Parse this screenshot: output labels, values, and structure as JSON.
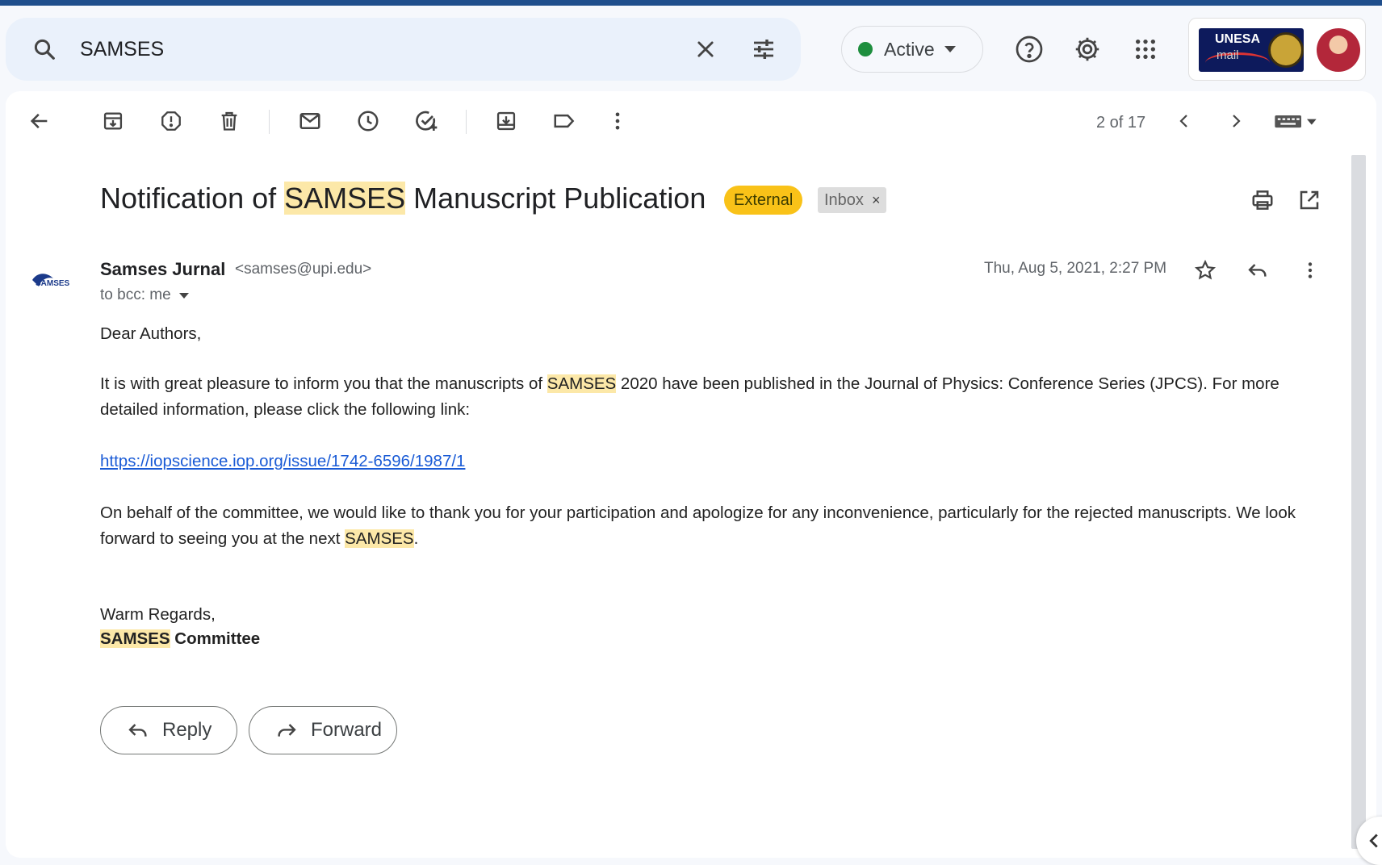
{
  "search": {
    "query": "SAMSES"
  },
  "status": {
    "label": "Active",
    "color": "#1e8e3e"
  },
  "account": {
    "org_logo_line1": "UNESA",
    "org_logo_line2": "mail"
  },
  "toolbar": {
    "pager": "2 of 17"
  },
  "email": {
    "subject_pre": "Notification of ",
    "subject_hl": "SAMSES",
    "subject_post": " Manuscript Publication",
    "label_external": "External",
    "label_inbox": "Inbox",
    "sender_name": "Samses Jurnal",
    "sender_email": "<samses@upi.edu>",
    "to_line": "to bcc: me",
    "date": "Thu, Aug 5, 2021, 2:27 PM",
    "body": {
      "greeting": "Dear Authors,",
      "p1_pre": "It is with great pleasure to inform you that the manuscripts of ",
      "p1_hl": "SAMSES",
      "p1_post": " 2020 have been published in the Journal of Physics: Conference Series (JPCS). For more detailed information, please click the following link:",
      "link": "https://iopscience.iop.org/issue/1742-6596/1987/1",
      "p2_pre": "On behalf of the committee, we would like to thank you for your participation and apologize for any inconvenience, particularly for the rejected manuscripts. We look forward to seeing you at the next ",
      "p2_hl": "SAMSES",
      "p2_post": ".",
      "closing": "Warm Regards,",
      "sig_hl": "SAMSES",
      "sig_post": " Committee"
    }
  },
  "actions": {
    "reply": "Reply",
    "forward": "Forward"
  },
  "colors": {
    "highlight": "#fce8a8",
    "external_badge": "#f9c218",
    "link": "#1a5bd6"
  }
}
